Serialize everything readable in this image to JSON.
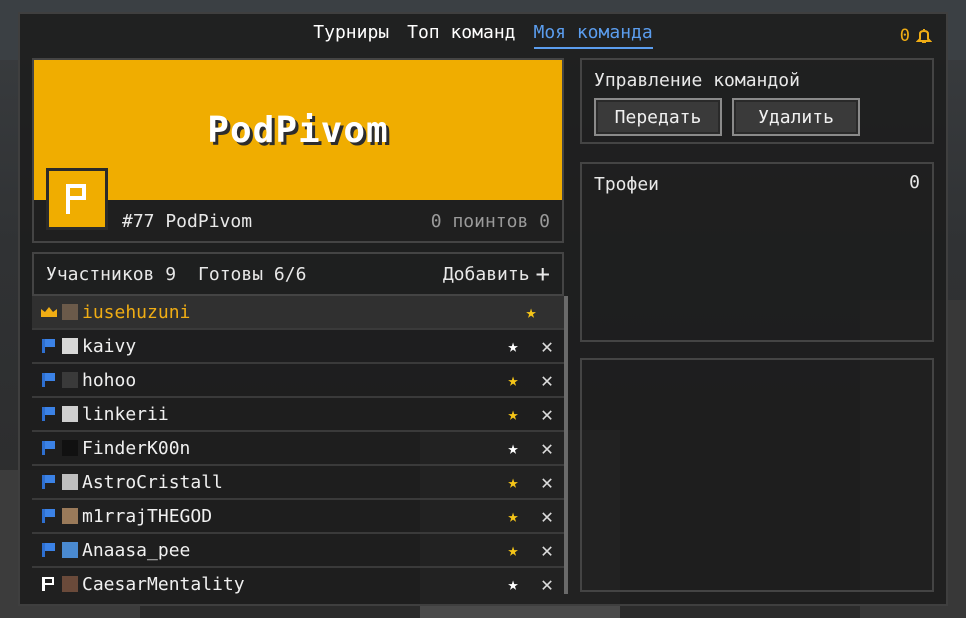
{
  "nav": {
    "tabs": [
      {
        "label": "Турниры"
      },
      {
        "label": "Топ команд"
      },
      {
        "label": "Моя команда"
      }
    ],
    "notifications_count": "0"
  },
  "team": {
    "name": "PodPivom",
    "rank_line": "#77 PodPivom",
    "points_line": "0 поинтов 0",
    "banner_color": "#f0ad00"
  },
  "members": {
    "count_label": "Участников 9",
    "ready_label": "Готовы 6/6",
    "add_label": "Добавить",
    "list": [
      {
        "name": "iusehuzuni",
        "role": "crown-icon",
        "star": "gold"
      },
      {
        "name": "kaivy",
        "role": "blue-flag-icon",
        "star": "white"
      },
      {
        "name": "hohoo",
        "role": "blue-flag-icon",
        "star": "gold"
      },
      {
        "name": "linkerii",
        "role": "blue-flag-icon",
        "star": "gold"
      },
      {
        "name": "FinderK00n",
        "role": "blue-flag-icon",
        "star": "white"
      },
      {
        "name": "AstroCristall",
        "role": "blue-flag-icon",
        "star": "gold"
      },
      {
        "name": "m1rrajTHEGOD",
        "role": "blue-flag-icon",
        "star": "gold"
      },
      {
        "name": "Anaasa_pee",
        "role": "blue-flag-icon",
        "star": "gold"
      },
      {
        "name": "CaesarMentality",
        "role": "white-flag-icon",
        "star": "white"
      }
    ]
  },
  "management": {
    "title": "Управление командой",
    "transfer_label": "Передать",
    "delete_label": "Удалить"
  },
  "trophies": {
    "title": "Трофеи",
    "count": "0"
  },
  "colors": {
    "accent": "#5b9dee",
    "gold": "#f0ad14",
    "star_gold": "#f5c518"
  }
}
